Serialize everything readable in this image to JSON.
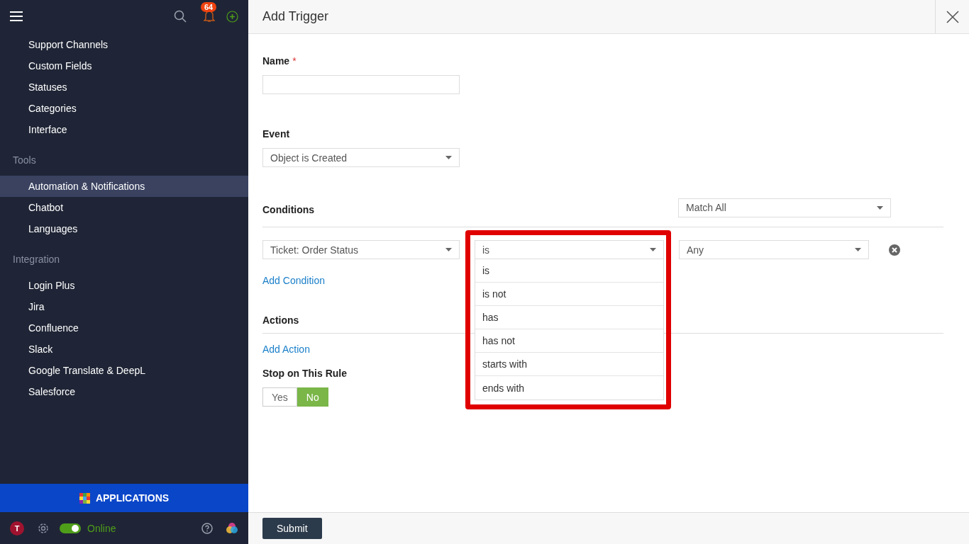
{
  "sidebar": {
    "notification_count": "64",
    "sections": [
      {
        "items": [
          {
            "label": "Support Channels",
            "selected": false
          },
          {
            "label": "Custom Fields",
            "selected": false
          },
          {
            "label": "Statuses",
            "selected": false
          },
          {
            "label": "Categories",
            "selected": false
          },
          {
            "label": "Interface",
            "selected": false
          }
        ]
      },
      {
        "heading": "Tools",
        "items": [
          {
            "label": "Automation & Notifications",
            "selected": true
          },
          {
            "label": "Chatbot",
            "selected": false
          },
          {
            "label": "Languages",
            "selected": false
          }
        ]
      },
      {
        "heading": "Integration",
        "items": [
          {
            "label": "Login Plus",
            "selected": false
          },
          {
            "label": "Jira",
            "selected": false
          },
          {
            "label": "Confluence",
            "selected": false
          },
          {
            "label": "Slack",
            "selected": false
          },
          {
            "label": "Google Translate & DeepL",
            "selected": false
          },
          {
            "label": "Salesforce",
            "selected": false
          }
        ]
      }
    ],
    "applications_button": "APPLICATIONS",
    "user_initial": "T",
    "status": {
      "on": true,
      "label": "Online"
    }
  },
  "panel": {
    "title": "Add Trigger",
    "name": {
      "label": "Name",
      "required_mark": "*"
    },
    "event": {
      "label": "Event",
      "value": "Object is Created"
    },
    "conditions": {
      "heading": "Conditions",
      "match": "Match All",
      "row": {
        "field": "Ticket: Order Status",
        "operator": "is",
        "value": "Any",
        "operator_open": true,
        "operator_options": [
          "is",
          "is not",
          "has",
          "has not",
          "starts with",
          "ends with"
        ]
      },
      "add_link": "Add Condition"
    },
    "actions": {
      "heading": "Actions",
      "add_link": "Add Action"
    },
    "stop_rule": {
      "label": "Stop on This Rule",
      "options": [
        {
          "label": "Yes",
          "selected": false
        },
        {
          "label": "No",
          "selected": true
        }
      ]
    },
    "submit": "Submit"
  }
}
